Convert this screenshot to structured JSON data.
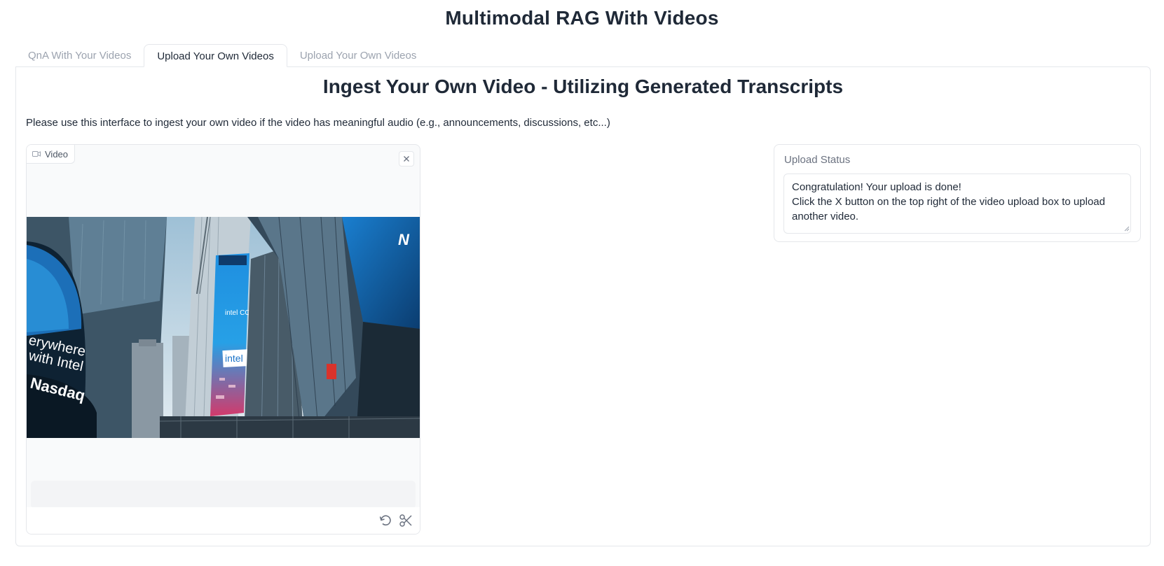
{
  "app": {
    "title": "Multimodal RAG With Videos"
  },
  "tabs": [
    {
      "label": "QnA With Your Videos",
      "active": false
    },
    {
      "label": "Upload Your Own Videos",
      "active": true
    },
    {
      "label": "Upload Your Own Videos",
      "active": false
    }
  ],
  "panel": {
    "heading": "Ingest Your Own Video - Utilizing Generated Transcripts",
    "description": "Please use this interface to ingest your own video if the video has meaningful audio (e.g., announcements, discussions, etc...)"
  },
  "video": {
    "label": "Video",
    "label_icon": "video-camera-icon",
    "clear_icon": "close-icon",
    "tools": [
      "undo-icon",
      "scissors-icon"
    ],
    "frame_text": {
      "billboard_left_1": "erywhere",
      "billboard_left_2": "with Intel",
      "billboard_nasdaq": "Nasdaq",
      "billboard_center": "intel",
      "billboard_center_small": "intel CORE",
      "logo_right": "N"
    }
  },
  "status": {
    "label": "Upload Status",
    "text": "Congratulation! Your upload is done!\nClick the X button on the top right of the video upload box to upload another video."
  },
  "colors": {
    "text": "#1f2937",
    "muted": "#9ca3af",
    "border": "#e5e7eb",
    "sky": "#c9dbe6"
  }
}
